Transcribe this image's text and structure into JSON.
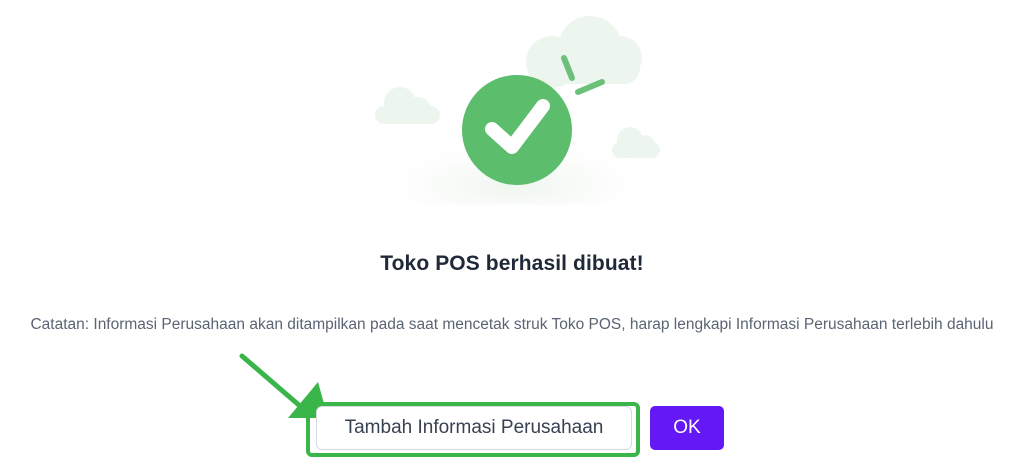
{
  "dialog": {
    "title": "Toko POS berhasil dibuat!",
    "note": "Catatan: Informasi Perusahaan akan ditampilkan pada saat mencetak struk Toko POS, harap lengkapi Informasi Perusahaan terlebih dahulu",
    "secondary_button_label": "Tambah Informasi Perusahaan",
    "primary_button_label": "OK"
  },
  "icons": {
    "success": "check-circle-icon",
    "annotation_arrow": "arrow-icon"
  },
  "colors": {
    "success_green": "#5cbd6c",
    "highlight_green": "#3ab54a",
    "primary_purple": "#6418f5",
    "title_text": "#1f2937",
    "note_text": "#5a6473"
  }
}
